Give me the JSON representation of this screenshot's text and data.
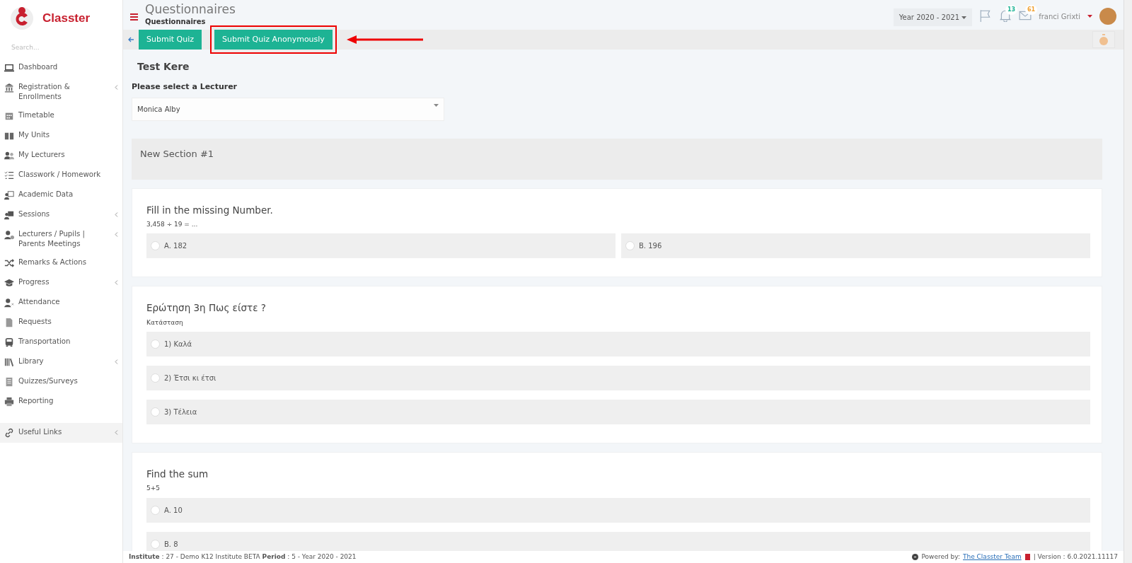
{
  "brand": {
    "name": "Classter"
  },
  "sidebar": {
    "search_placeholder": "Search...",
    "items": [
      {
        "label": "Dashboard",
        "has_submenu": false
      },
      {
        "label": "Registration & Enrollments",
        "has_submenu": true
      },
      {
        "label": "Timetable",
        "has_submenu": false
      },
      {
        "label": "My Units",
        "has_submenu": false
      },
      {
        "label": "My Lecturers",
        "has_submenu": false
      },
      {
        "label": "Classwork / Homework",
        "has_submenu": false
      },
      {
        "label": "Academic Data",
        "has_submenu": false
      },
      {
        "label": "Sessions",
        "has_submenu": true
      },
      {
        "label": "Lecturers / Pupils | Parents Meetings",
        "has_submenu": true
      },
      {
        "label": "Remarks & Actions",
        "has_submenu": false
      },
      {
        "label": "Progress",
        "has_submenu": true
      },
      {
        "label": "Attendance",
        "has_submenu": false
      },
      {
        "label": "Requests",
        "has_submenu": false
      },
      {
        "label": "Transportation",
        "has_submenu": false
      },
      {
        "label": "Library",
        "has_submenu": true
      },
      {
        "label": "Quizzes/Surveys",
        "has_submenu": false
      },
      {
        "label": "Reporting",
        "has_submenu": false
      }
    ],
    "footer_item": {
      "label": "Useful Links",
      "has_submenu": true
    }
  },
  "header": {
    "title": "Questionnaires",
    "subtitle": "Questionnaires",
    "year": "Year 2020 - 2021",
    "notifications": "13",
    "messages": "61",
    "user": "franci Grixti"
  },
  "toolbar": {
    "buttons": [
      {
        "label": "Submit Quiz",
        "highlighted": false
      },
      {
        "label": "Submit Quiz Anonymously",
        "highlighted": true
      }
    ]
  },
  "quiz": {
    "title": "Test Kere",
    "lecturer_label": "Please select a Lecturer",
    "lecturer": "Monica Alby",
    "section": "New Section #1",
    "questions": [
      {
        "title": "Fill in the missing Number.",
        "prompt": "3,458 ÷ 19 = ...",
        "kind": "grid",
        "options": [
          {
            "label": "A. 182",
            "selected": false
          },
          {
            "label": "B. 196",
            "selected": false
          }
        ]
      },
      {
        "title": "Ερώτηση 3η Πως είστε ?",
        "prompt": "Κατάσταση",
        "kind": "list",
        "options": [
          {
            "label": "1) Καλά",
            "selected": false
          },
          {
            "label": "2) Έτσι κι έτσι",
            "selected": false
          },
          {
            "label": "3) Τέλεια",
            "selected": false
          }
        ]
      },
      {
        "title": "Find the sum",
        "prompt": "5+5",
        "kind": "list",
        "options": [
          {
            "label": "A. 10",
            "selected": false
          },
          {
            "label": "B. 8",
            "selected": false
          }
        ]
      }
    ]
  },
  "footer": {
    "info": "**Institute** : 27 - Demo K12 Institute BETA **Period** : 5 - Year 2020 - 2021",
    "powered": "Powered by:",
    "team": "The Classter Team",
    "version": "| Version : 6.0.2021.11117"
  }
}
